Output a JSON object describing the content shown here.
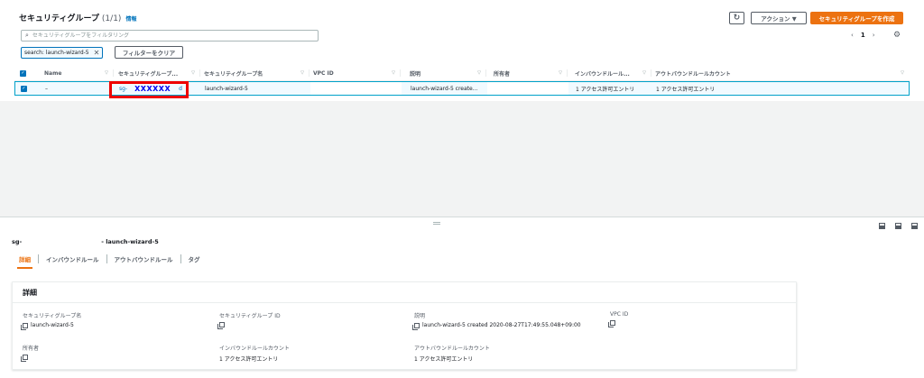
{
  "header": {
    "title": "セキュリティグループ",
    "count": "(1/1)",
    "info": "情報",
    "refresh_icon": "↻",
    "actions_label": "アクション ▼",
    "create_label": "セキュリティグループを作成"
  },
  "search": {
    "icon": "🔍",
    "placeholder": "セキュリティグループをフィルタリング",
    "token": "search: launch-wizard-5",
    "token_remove": "✕",
    "clear_label": "フィルターをクリア"
  },
  "pagination": {
    "prev": "‹",
    "page": "1",
    "next": "›",
    "settings_icon": "⚙"
  },
  "table": {
    "columns": [
      "Name",
      "セキュリティグループ...",
      "セキュリティグループ名",
      "VPC ID",
      "説明",
      "所有者",
      "インバウンドルール...",
      "アウトバウンドルールカウント"
    ],
    "rows": [
      {
        "name": "–",
        "sg_prefix": "sg-",
        "sg_mask": "XXXXXX",
        "sg_suffix": "d",
        "group_name": "launch-wizard-5",
        "vpc_id": "",
        "description": "launch-wizard-5 create...",
        "owner": "",
        "inbound": "1 アクセス許可エントリ",
        "outbound": "1 アクセス許可エントリ"
      }
    ]
  },
  "detail": {
    "sg_prefix": "sg-",
    "sg_name_suffix": "- launch-wizard-5",
    "tabs": [
      "詳細",
      "インバウンドルール",
      "アウトバウンドルール",
      "タグ"
    ],
    "section_title": "詳細",
    "fields": {
      "group_name_label": "セキュリティグループ名",
      "group_name_value": "launch-wizard-5",
      "group_id_label": "セキュリティグループ ID",
      "group_id_value": "",
      "description_label": "説明",
      "description_value": "launch-wizard-5 created 2020-08-27T17:49:55.048+09:00",
      "vpc_label": "VPC ID",
      "vpc_value": "",
      "owner_label": "所有者",
      "owner_value": "",
      "inbound_label": "インバウンドルールカウント",
      "inbound_value": "1 アクセス許可エントリ",
      "outbound_label": "アウトバウンドルールカウント",
      "outbound_value": "1 アクセス許可エントリ"
    }
  },
  "colors": {
    "accent": "#ec7211",
    "link": "#0073bb",
    "highlight": "#e00"
  }
}
